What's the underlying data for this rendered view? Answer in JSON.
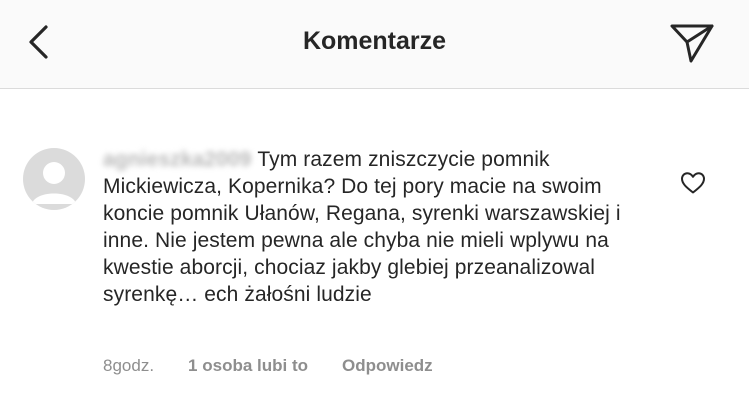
{
  "header": {
    "title": "Komentarze",
    "back_icon": "chevron-left-icon",
    "send_icon": "paper-plane-icon"
  },
  "comment": {
    "username": "agnieszka2009",
    "text": "Tym razem zniszczycie pomnik Mickiewicza, Kopernika? Do tej pory macie na swoim koncie pomnik Ułanów, Regana, syrenki warszawskiej i inne. Nie jestem pewna ale chyba nie mieli wplywu na kwestie aborcji, chociaz jakby glebiej przeanalizowal syrenkę… ech żałośni ludzie",
    "time": "8godz.",
    "likes": "1 osoba lubi to",
    "reply": "Odpowiedz",
    "like_icon": "heart-outline-icon"
  },
  "colors": {
    "text": "#262626",
    "secondary": "#8e8e8e",
    "header_bg": "#fafafa",
    "divider": "#dbdbdb"
  }
}
